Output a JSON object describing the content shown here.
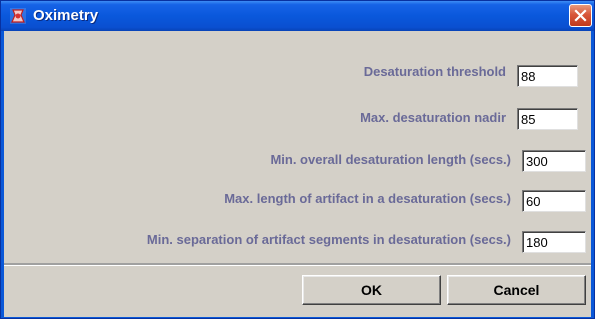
{
  "window": {
    "title": "Oximetry"
  },
  "fields": [
    {
      "label": "Desaturation threshold",
      "value": "88"
    },
    {
      "label": "Max. desaturation nadir",
      "value": "85"
    },
    {
      "label": "Min. overall desaturation length (secs.)",
      "value": "300"
    },
    {
      "label": "Max. length of artifact in a desaturation (secs.)",
      "value": "60"
    },
    {
      "label": "Min. separation of artifact segments in desaturation (secs.)",
      "value": "180"
    }
  ],
  "buttons": {
    "ok": "OK",
    "cancel": "Cancel"
  }
}
